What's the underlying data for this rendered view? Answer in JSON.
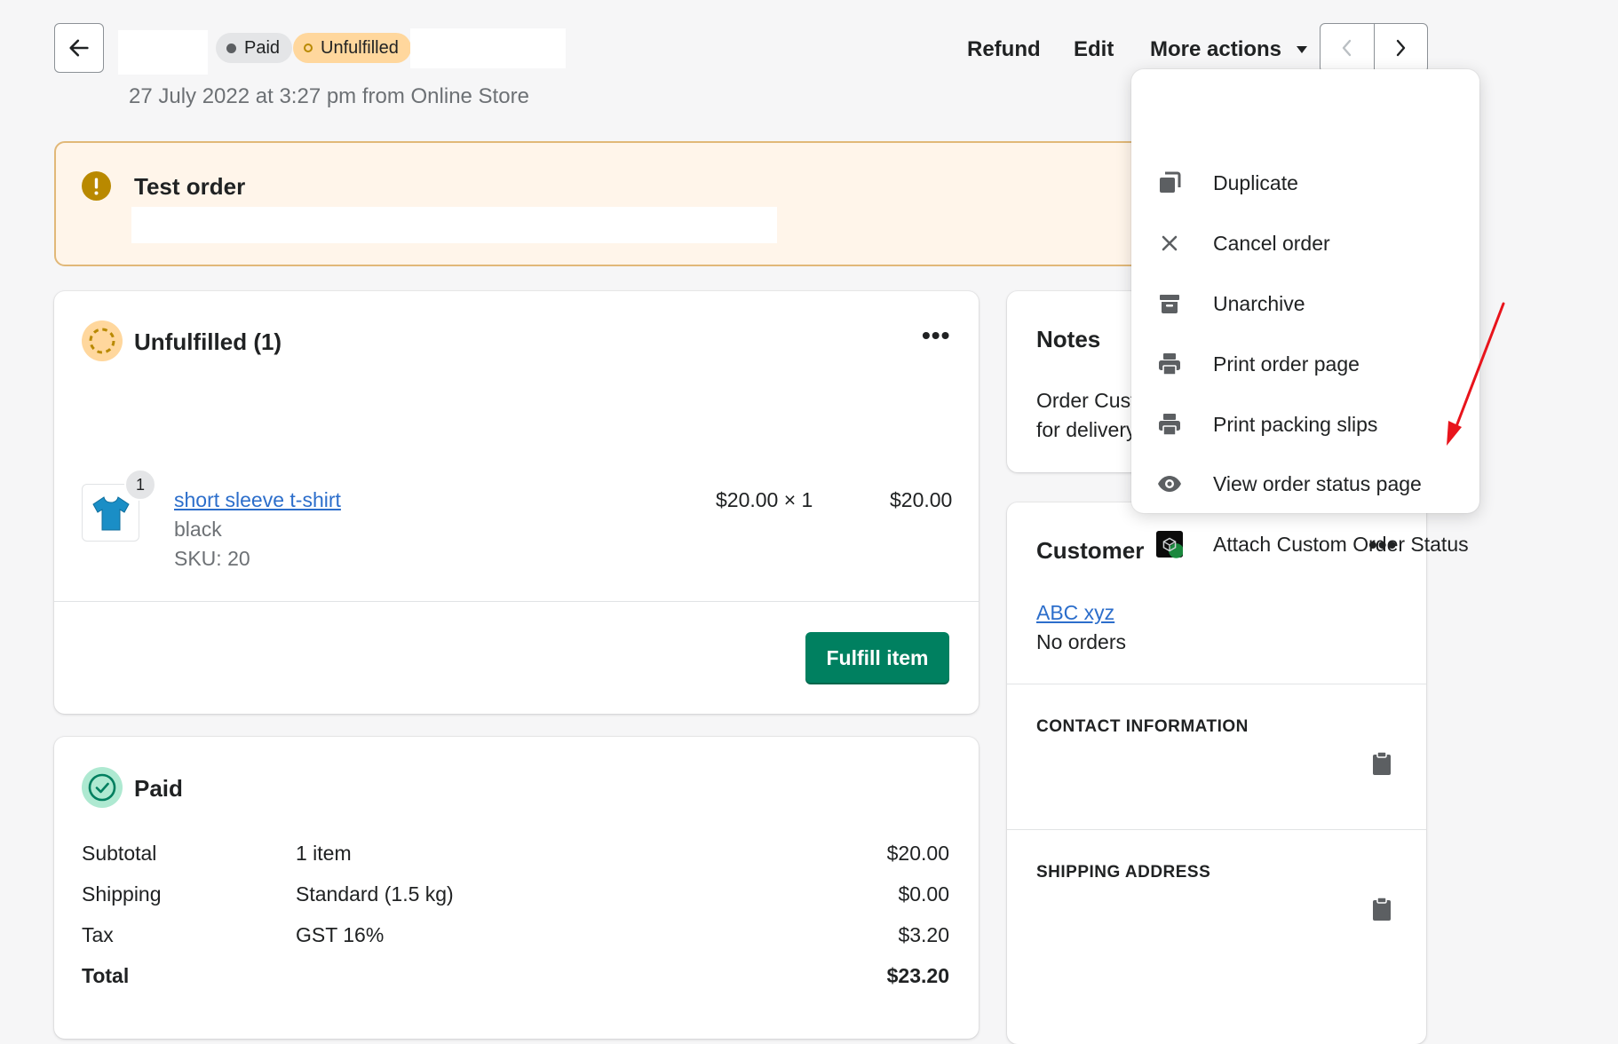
{
  "header": {
    "badges": {
      "paid": "Paid",
      "unfulfilled": "Unfulfilled"
    },
    "subtitle": "27 July 2022 at 3:27 pm from Online Store",
    "actions": {
      "refund": "Refund",
      "edit": "Edit",
      "more": "More actions"
    }
  },
  "banner": {
    "title": "Test order"
  },
  "unfulfilled_card": {
    "title": "Unfulfilled (1)",
    "item": {
      "qty_badge": "1",
      "name": "short sleeve t-shirt",
      "variant": "black",
      "sku": "SKU: 20",
      "unit_price": "$20.00 × 1",
      "line_total": "$20.00"
    },
    "fulfill_button": "Fulfill item"
  },
  "paid_card": {
    "title": "Paid",
    "rows": [
      {
        "label": "Subtotal",
        "desc": "1 item",
        "amount": "$20.00"
      },
      {
        "label": "Shipping",
        "desc": "Standard (1.5 kg)",
        "amount": "$0.00"
      },
      {
        "label": "Tax",
        "desc": "GST 16%",
        "amount": "$3.20"
      },
      {
        "label": "Total",
        "desc": "",
        "amount": "$23.20"
      }
    ]
  },
  "notes_card": {
    "title": "Notes",
    "line1": "Order Cust",
    "line2": "for delivery"
  },
  "customer_card": {
    "title": "Customer",
    "name": "ABC xyz",
    "orders": "No orders",
    "contact_label": "CONTACT INFORMATION",
    "shipping_label": "SHIPPING ADDRESS"
  },
  "more_actions_menu": {
    "items": [
      {
        "label": "Duplicate",
        "icon": "duplicate-icon"
      },
      {
        "label": "Cancel order",
        "icon": "close-icon"
      },
      {
        "label": "Unarchive",
        "icon": "archive-icon"
      },
      {
        "label": "Print order page",
        "icon": "printer-icon"
      },
      {
        "label": "Print packing slips",
        "icon": "printer-icon"
      },
      {
        "label": "View order status page",
        "icon": "eye-icon"
      },
      {
        "label": "Attach Custom Order Status",
        "icon": "app-logo-icon"
      }
    ]
  },
  "colors": {
    "primary_button": "#008060",
    "banner_bg": "#fff5ea",
    "unfulfilled_badge": "#ffd79d",
    "link": "#2c6ecb",
    "annotation_arrow": "#e8141c"
  }
}
